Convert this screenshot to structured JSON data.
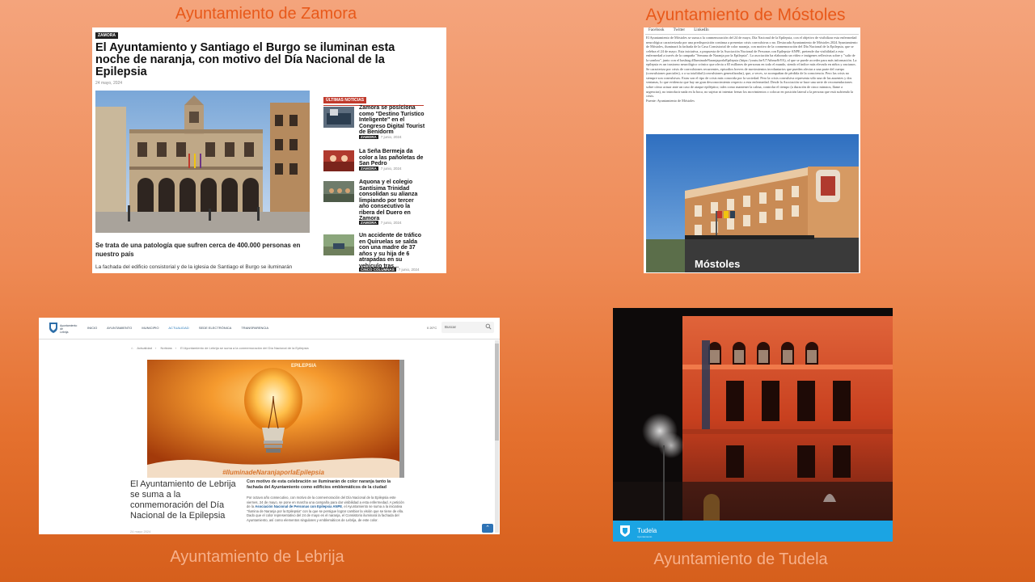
{
  "captions": {
    "zamora": "Ayuntamiento de Zamora",
    "mostoles": "Ayuntamiento de Móstoles",
    "lebrija": "Ayuntamiento de Lebrija",
    "tudela": "Ayuntamiento de Tudela"
  },
  "zamora": {
    "tag": "ZAMORA",
    "title": "El Ayuntamiento y Santiago el Burgo se iluminan esta noche de naranja, con motivo del Día Nacional de la Epilepsia",
    "date": "24 mayo, 2024",
    "subtitle": "Se trata de una patología que sufren cerca de 400.000 personas en nuestro país",
    "body": "La fachada del edificio consistorial y de la iglesia de Santiago el Burgo se iluminarán",
    "latest_label": "ÚLTIMAS NOTICIAS",
    "news": [
      {
        "title": "Zamora se posiciona como \"Destino Turístico Inteligente\" en el Congreso Digital Tourist de Benidorm",
        "tag": "ZAMORA",
        "date": "7 junio, 2024"
      },
      {
        "title": "La Seña Bermeja da color a las pañoletas de San Pedro",
        "tag": "ZAMORA",
        "date": "7 junio, 2024"
      },
      {
        "title": "Aquona y el colegio Santísima Trinidad consolidan su alianza limpiando por tercer año consecutivo la ribera del Duero en Zamora",
        "tag": "ZAMORA",
        "date": "7 junio, 2024"
      },
      {
        "title": "Un accidente de tráfico en Quiruelas se salda con una madre de 37 años y su hija de 6 atrapadas en su vehículo tras...",
        "tag": "CINCO COLUMNAS",
        "date": "7 junio, 2024"
      }
    ]
  },
  "mostoles": {
    "menu": [
      "Facebook",
      "Twitter",
      "LinkedIn"
    ],
    "text": "El Ayuntamiento de Móstoles se suma a la conmemoración del 24 de mayo, Día Nacional de la Epilepsia, con el objetivo de visibilizar esta enfermedad neurológica caracterizada por una predisposición continua a presentar crisis convulsivas o no. Destacada Ayuntamiento de Móstoles 2024 Ayuntamiento de Móstoles, iluminará la fachada de la Casa Consistorial de color naranja, con motivo de la conmemoración del Día Nacional de la Epilepsia, que se celebra el 24 de mayo. Esta iniciativa, a propuesta de la Asociación Nacional de Personas con Epilepsia-ANPE, pretende dar visibilidad a esta enfermedad a través de la campaña \"Semana de Naranja por la Epilepsia\". La asociación ha elaborado un vídeo e imágenes reflexivas sobre y \"salir de la sombra\", junto con el hashtag #IluminadeNaranjaporlaEpilepsia (https://youtu.be/U7Athmz8rYA), al que se puede acceder para más información. La epilepsia es un trastorno neurológico crónico que afecta a 65 millones de personas en todo el mundo, siendo el índice más elevado en niños y ancianos. Se caracteriza por crisis de convulsiones recurrentes, episodios breves de movimientos involuntarios que pueden afectar a una parte del cuerpo (convulsiones parciales), o a su totalidad (convulsiones generalizadas), que, a veces, se acompañan de pérdida de la consciencia. Pero las crisis no siempre son convulsivas. Estas son el tipo de crisis más conocida por la sociedad. Pero la crisis convulsiva representa sólo una de las ausentes y dos ventanas, lo que evidencia que hay un gran desconocimiento respecto a esta enfermedad. Desde la Asociación se hace una serie de recomendaciones sobre cómo actuar ante un caso de ataque epiléptico; tales como mantener la calma, controlar el tiempo (a duración de cinco minutos, llame a urgencias), no introducir nada en la boca, no sujetar ni intentar frenar los movimientos o colocar en posición lateral a la persona que está sufriendo la crisis.",
    "source": "Fuente: Ayuntamiento de Móstoles",
    "photo_sign": "Móstoles"
  },
  "lebrija": {
    "logo_text": "Ayuntamiento de Lebrija",
    "menu": [
      "INICIO",
      "AYUNTAMIENTO",
      "MUNICIPIO",
      "ACTUALIDAD",
      "SEDE ELECTRÓNICA",
      "TRANSPARENCIA"
    ],
    "active_menu": "ACTUALIDAD",
    "temperature": "0 20°C",
    "search_placeholder": "Buscar",
    "breadcrumb": [
      "Actualidad",
      "Noticias",
      "El Ayuntamiento de Lebrija se suma a la conmemoración del Día Nacional de la Epilepsia"
    ],
    "poster_top": "EPILEPSIA",
    "poster_hashtag": "#IluminadeNaranjaporlaEpilepsia",
    "title": "El Ayuntamiento de Lebrija se suma a la conmemoración del Día Nacional de la Epilepsia",
    "lead": "Con motivo de esta celebración se iluminarán de color naranja tanto la fachada del Ayuntamiento como edificios emblemáticos de la ciudad",
    "body_before": "Por octavo año consecutivo, con motivo de la conmemoración del Día Nacional de la Epilepsia este viernes, 24 de mayo, se pone en marcha una campaña para dar visibilidad a esta enfermedad. A petición de la ",
    "body_link": "Asociación Nacional de Personas con Epilepsia ANPE",
    "body_after": ", el Ayuntamiento se suma a la iniciativa \"Ilumina de Naranja por la Epilepsia\" con la que se persigue lograr cambiar la visión que se tiene de ella. Dado que el color representativo del 24 de mayo es el naranja, el Consistorio iluminará la fachada del Ayuntamiento, así como elementos singulares y emblemáticos de Lebrija, de este color.",
    "meta": "24 mayo 2024"
  },
  "tudela": {
    "name": "Tudela",
    "subtitle": "Ayuntamiento"
  }
}
